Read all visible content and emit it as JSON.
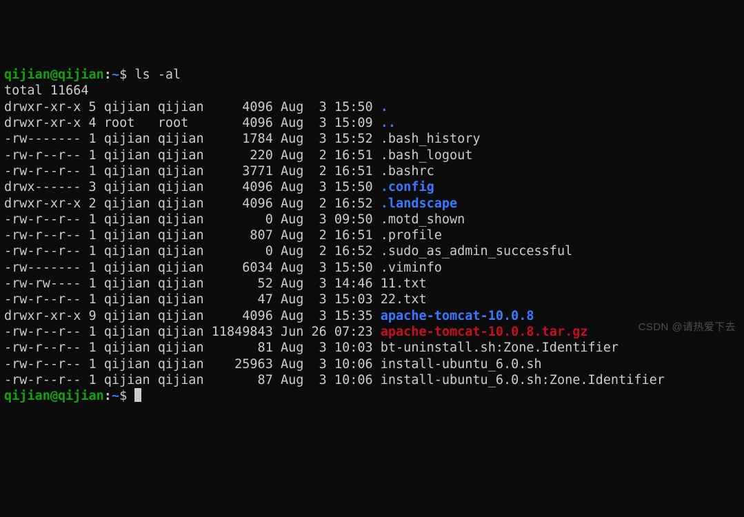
{
  "prompt": {
    "userhost": "qijian@qijian",
    "colon": ":",
    "path": "~",
    "dollar": "$"
  },
  "command": "ls -al",
  "total_line": "total 11664",
  "rows": [
    {
      "perm": "drwxr-xr-x",
      "ln": "5",
      "own": "qijian",
      "grp": "qijian",
      "size": "4096",
      "mon": "Aug",
      "day": "3",
      "time": "15:50",
      "name": ".",
      "cls": "dir"
    },
    {
      "perm": "drwxr-xr-x",
      "ln": "4",
      "own": "root",
      "grp": "root",
      "size": "4096",
      "mon": "Aug",
      "day": "3",
      "time": "15:09",
      "name": "..",
      "cls": "dir"
    },
    {
      "perm": "-rw-------",
      "ln": "1",
      "own": "qijian",
      "grp": "qijian",
      "size": "1784",
      "mon": "Aug",
      "day": "3",
      "time": "15:52",
      "name": ".bash_history",
      "cls": "file"
    },
    {
      "perm": "-rw-r--r--",
      "ln": "1",
      "own": "qijian",
      "grp": "qijian",
      "size": "220",
      "mon": "Aug",
      "day": "2",
      "time": "16:51",
      "name": ".bash_logout",
      "cls": "file"
    },
    {
      "perm": "-rw-r--r--",
      "ln": "1",
      "own": "qijian",
      "grp": "qijian",
      "size": "3771",
      "mon": "Aug",
      "day": "2",
      "time": "16:51",
      "name": ".bashrc",
      "cls": "file"
    },
    {
      "perm": "drwx------",
      "ln": "3",
      "own": "qijian",
      "grp": "qijian",
      "size": "4096",
      "mon": "Aug",
      "day": "3",
      "time": "15:50",
      "name": ".config",
      "cls": "dir"
    },
    {
      "perm": "drwxr-xr-x",
      "ln": "2",
      "own": "qijian",
      "grp": "qijian",
      "size": "4096",
      "mon": "Aug",
      "day": "2",
      "time": "16:52",
      "name": ".landscape",
      "cls": "dir"
    },
    {
      "perm": "-rw-r--r--",
      "ln": "1",
      "own": "qijian",
      "grp": "qijian",
      "size": "0",
      "mon": "Aug",
      "day": "3",
      "time": "09:50",
      "name": ".motd_shown",
      "cls": "file"
    },
    {
      "perm": "-rw-r--r--",
      "ln": "1",
      "own": "qijian",
      "grp": "qijian",
      "size": "807",
      "mon": "Aug",
      "day": "2",
      "time": "16:51",
      "name": ".profile",
      "cls": "file"
    },
    {
      "perm": "-rw-r--r--",
      "ln": "1",
      "own": "qijian",
      "grp": "qijian",
      "size": "0",
      "mon": "Aug",
      "day": "2",
      "time": "16:52",
      "name": ".sudo_as_admin_successful",
      "cls": "file"
    },
    {
      "perm": "-rw-------",
      "ln": "1",
      "own": "qijian",
      "grp": "qijian",
      "size": "6034",
      "mon": "Aug",
      "day": "3",
      "time": "15:50",
      "name": ".viminfo",
      "cls": "file"
    },
    {
      "perm": "-rw-rw----",
      "ln": "1",
      "own": "qijian",
      "grp": "qijian",
      "size": "52",
      "mon": "Aug",
      "day": "3",
      "time": "14:46",
      "name": "11.txt",
      "cls": "file"
    },
    {
      "perm": "-rw-r--r--",
      "ln": "1",
      "own": "qijian",
      "grp": "qijian",
      "size": "47",
      "mon": "Aug",
      "day": "3",
      "time": "15:03",
      "name": "22.txt",
      "cls": "file"
    },
    {
      "perm": "drwxr-xr-x",
      "ln": "9",
      "own": "qijian",
      "grp": "qijian",
      "size": "4096",
      "mon": "Aug",
      "day": "3",
      "time": "15:35",
      "name": "apache-tomcat-10.0.8",
      "cls": "dir"
    },
    {
      "perm": "-rw-r--r--",
      "ln": "1",
      "own": "qijian",
      "grp": "qijian",
      "size": "11849843",
      "mon": "Jun",
      "day": "26",
      "time": "07:23",
      "name": "apache-tomcat-10.0.8.tar.gz",
      "cls": "ar"
    },
    {
      "perm": "-rw-r--r--",
      "ln": "1",
      "own": "qijian",
      "grp": "qijian",
      "size": "81",
      "mon": "Aug",
      "day": "3",
      "time": "10:03",
      "name": "bt-uninstall.sh:Zone.Identifier",
      "cls": "file"
    },
    {
      "perm": "-rw-r--r--",
      "ln": "1",
      "own": "qijian",
      "grp": "qijian",
      "size": "25963",
      "mon": "Aug",
      "day": "3",
      "time": "10:06",
      "name": "install-ubuntu_6.0.sh",
      "cls": "file"
    },
    {
      "perm": "-rw-r--r--",
      "ln": "1",
      "own": "qijian",
      "grp": "qijian",
      "size": "87",
      "mon": "Aug",
      "day": "3",
      "time": "10:06",
      "name": "install-ubuntu_6.0.sh:Zone.Identifier",
      "cls": "file"
    }
  ],
  "watermark": "CSDN @请热爱下去"
}
